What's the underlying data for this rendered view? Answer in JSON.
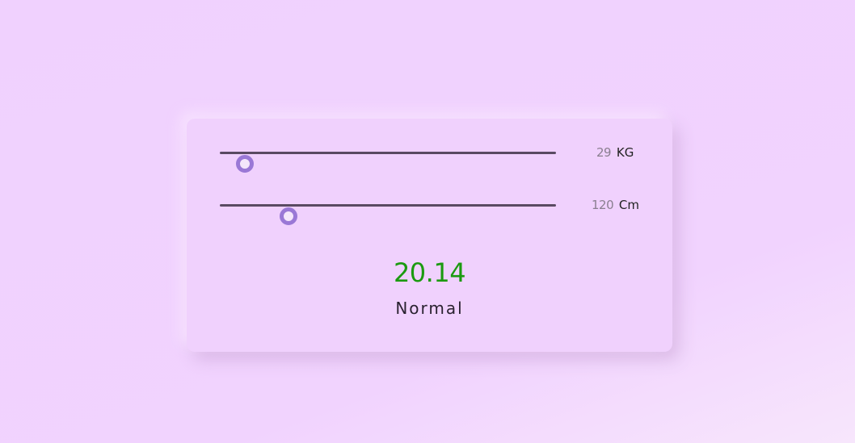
{
  "weight_slider": {
    "value": "29",
    "unit": "KG",
    "fraction": 0.075
  },
  "height_slider": {
    "value": "120",
    "unit": "Cm",
    "fraction": 0.205
  },
  "result": {
    "bmi": "20.14",
    "status": "Normal"
  },
  "colors": {
    "background": "#f1d3fe",
    "track": "#5a4a62",
    "thumb_border": "#9a78d6",
    "bmi_value": "#1b9a10",
    "status_text": "#2a2230"
  }
}
